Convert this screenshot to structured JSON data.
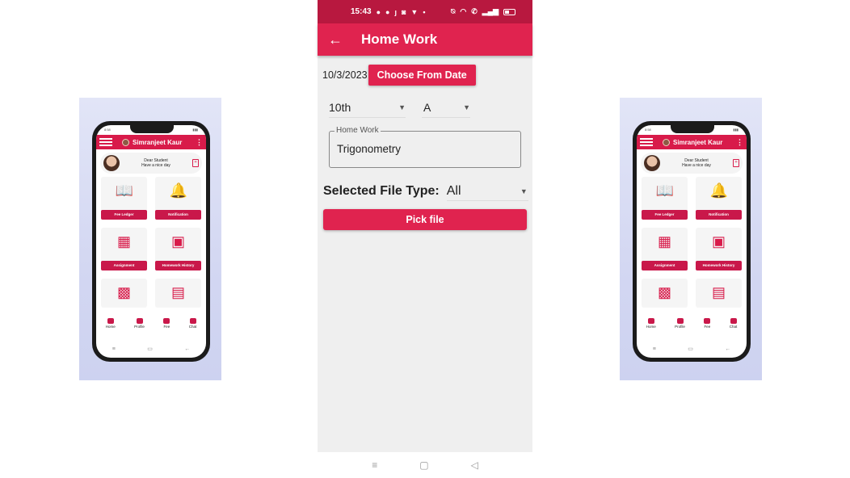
{
  "status_bar": {
    "time": "15:43"
  },
  "app_bar": {
    "title": "Home Work",
    "back_icon": "arrow-left-icon"
  },
  "form": {
    "date_value": "10/3/2023",
    "choose_date_label": "Choose From Date",
    "class_select": {
      "value": "10th"
    },
    "section_select": {
      "value": "A"
    },
    "homework_field": {
      "label": "Home Work",
      "value": "Trigonometry"
    },
    "file_type_label": "Selected File Type:",
    "file_type_select": {
      "value": "All"
    },
    "pick_file_label": "Pick file"
  },
  "colors": {
    "accent": "#e0234f",
    "status_bar": "#b8183f",
    "background": "#efefef"
  },
  "system_nav": {
    "recents": "≡",
    "home": "▢",
    "back": "◁"
  },
  "mockup": {
    "user_name": "Simranjeet Kaur",
    "status_time": "8:58",
    "greeting_line1": "Dear Student",
    "greeting_line2": "Have a nice day",
    "tiles": [
      {
        "label": "Fee Ledger",
        "icon": "book-icon"
      },
      {
        "label": "Notification",
        "icon": "bell-icon"
      },
      {
        "label": "Assignment",
        "icon": "calendar-icon"
      },
      {
        "label": "Homework History",
        "icon": "monitor-icon"
      },
      {
        "label": "",
        "icon": "easel-icon"
      },
      {
        "label": "",
        "icon": "clipboard-icon"
      }
    ],
    "bottom_nav": [
      {
        "label": "Home",
        "icon": "home-icon"
      },
      {
        "label": "Profile",
        "icon": "profile-icon"
      },
      {
        "label": "Fee",
        "icon": "money-bag-icon"
      },
      {
        "label": "Chat",
        "icon": "chat-icon"
      }
    ]
  }
}
